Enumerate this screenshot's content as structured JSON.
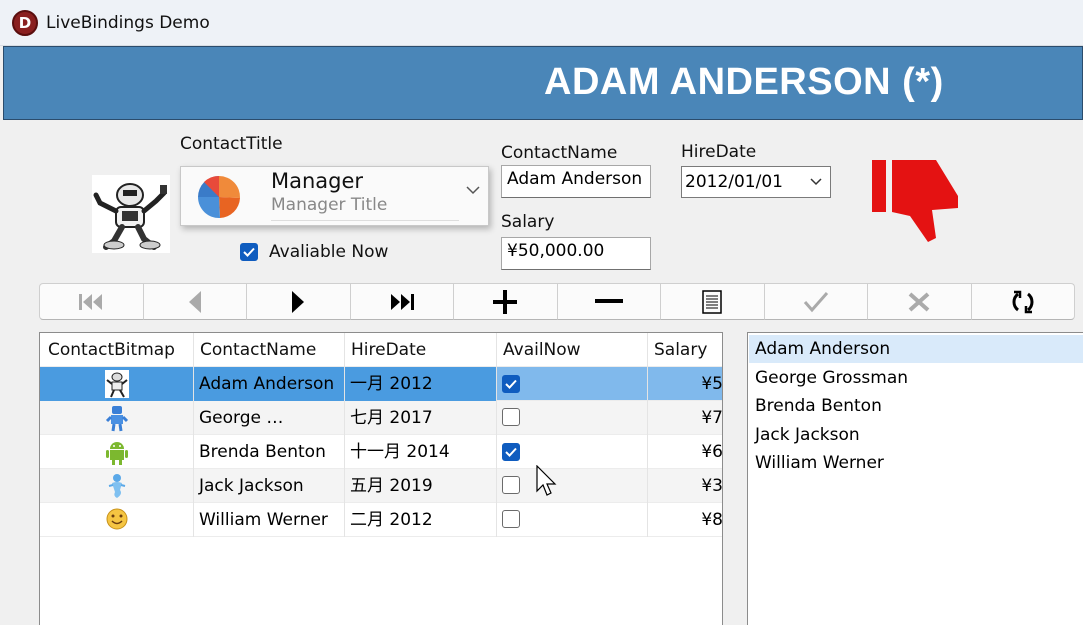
{
  "window": {
    "title": "LiveBindings Demo",
    "logo_letter": "D"
  },
  "header": {
    "title": "ADAM ANDERSON (*)",
    "background": "#4a86b8"
  },
  "form": {
    "contact_title_label": "ContactTitle",
    "contact_title_value": "Manager",
    "contact_title_sub": "Manager Title",
    "available_label": "Avaliable Now",
    "available_checked": true,
    "contact_name_label": "ContactName",
    "contact_name_value": "Adam Anderson",
    "hire_date_label": "HireDate",
    "hire_date_value": "2012/01/01",
    "salary_label": "Salary",
    "salary_value": "¥50,000.00",
    "status_icon": "thumbs-down-icon",
    "status_color": "#e41212"
  },
  "navigator": {
    "buttons": [
      "first-icon",
      "prior-icon",
      "next-icon",
      "last-icon",
      "insert-icon",
      "delete-icon",
      "edit-icon",
      "post-icon",
      "cancel-icon",
      "refresh-icon"
    ],
    "enabled": [
      false,
      false,
      true,
      true,
      true,
      true,
      true,
      false,
      false,
      true
    ]
  },
  "grid": {
    "columns": [
      "ContactBitmap",
      "ContactName",
      "HireDate",
      "AvailNow",
      "Salary"
    ],
    "rows": [
      {
        "bitmap": "robot-icon",
        "name": "Adam Anderson",
        "hire": "一月 2012",
        "avail": true,
        "salary": "¥5"
      },
      {
        "bitmap": "blue-robot-icon",
        "name": "George …",
        "hire": "七月 2017",
        "avail": false,
        "salary": "¥7"
      },
      {
        "bitmap": "android-icon",
        "name": "Brenda Benton",
        "hire": "十一月 2014",
        "avail": true,
        "salary": "¥6"
      },
      {
        "bitmap": "genie-icon",
        "name": "Jack Jackson",
        "hire": "五月 2019",
        "avail": false,
        "salary": "¥3"
      },
      {
        "bitmap": "smiley-icon",
        "name": "William Werner",
        "hire": "二月 2012",
        "avail": false,
        "salary": "¥8"
      }
    ],
    "selected_row": 0
  },
  "contact_list": {
    "items": [
      "Adam Anderson",
      "George Grossman",
      "Brenda Benton",
      "Jack Jackson",
      "William Werner"
    ],
    "selected": 0
  }
}
